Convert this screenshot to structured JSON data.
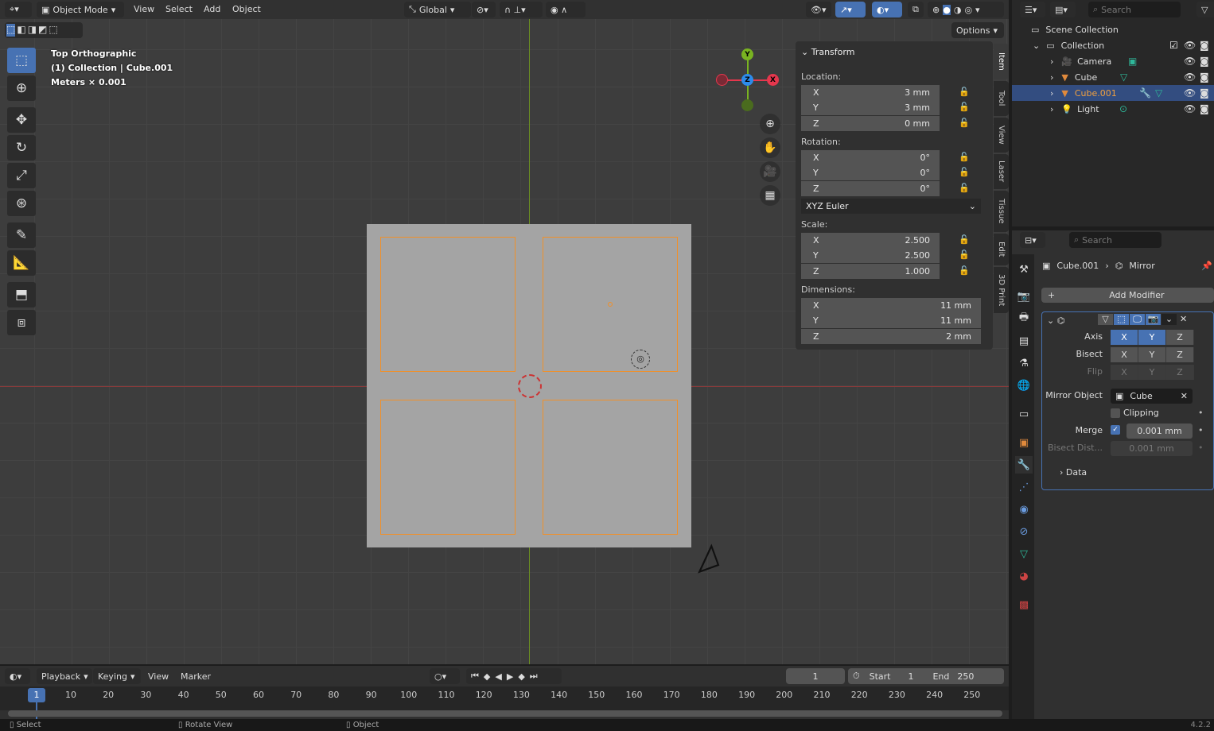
{
  "header": {
    "mode": "Object Mode",
    "menus": [
      "View",
      "Select",
      "Add",
      "Object"
    ],
    "orientation": "Global",
    "options_label": "Options"
  },
  "overlay": {
    "view_name": "Top Orthographic",
    "collection_line": "(1) Collection | Cube.001",
    "units": "Meters × 0.001"
  },
  "gizmo": {
    "x": "X",
    "y": "Y",
    "z": "Z",
    "x_color": "#e5374d",
    "y_color": "#79b321",
    "z_color": "#2d8ceb"
  },
  "npanel": {
    "panel_title": "Transform",
    "location_label": "Location:",
    "location": [
      {
        "axis": "X",
        "value": "3 mm"
      },
      {
        "axis": "Y",
        "value": "3 mm"
      },
      {
        "axis": "Z",
        "value": "0 mm"
      }
    ],
    "rotation_label": "Rotation:",
    "rotation": [
      {
        "axis": "X",
        "value": "0°"
      },
      {
        "axis": "Y",
        "value": "0°"
      },
      {
        "axis": "Z",
        "value": "0°"
      }
    ],
    "rotation_mode": "XYZ Euler",
    "scale_label": "Scale:",
    "scale": [
      {
        "axis": "X",
        "value": "2.500"
      },
      {
        "axis": "Y",
        "value": "2.500"
      },
      {
        "axis": "Z",
        "value": "1.000"
      }
    ],
    "dimensions_label": "Dimensions:",
    "dimensions": [
      {
        "axis": "X",
        "value": "11 mm"
      },
      {
        "axis": "Y",
        "value": "11 mm"
      },
      {
        "axis": "Z",
        "value": "2 mm"
      }
    ],
    "tabs": [
      "Item",
      "Tool",
      "View",
      "Laser",
      "Tissue",
      "Edit",
      "3D Print"
    ],
    "active_tab": "Item"
  },
  "outliner": {
    "search_placeholder": "Search",
    "scene_collection": "Scene Collection",
    "items": [
      {
        "name": "Collection"
      },
      {
        "name": "Camera"
      },
      {
        "name": "Cube"
      },
      {
        "name": "Cube.001",
        "selected": true
      },
      {
        "name": "Light"
      }
    ]
  },
  "properties": {
    "search_placeholder": "Search",
    "object": "Cube.001",
    "modifier": "Mirror",
    "add_modifier": "Add Modifier",
    "axis_label": "Axis",
    "bisect_label": "Bisect",
    "flip_label": "Flip",
    "axes": [
      "X",
      "Y",
      "Z"
    ],
    "axis_enabled": [
      true,
      true,
      false
    ],
    "mirror_object_label": "Mirror Object",
    "mirror_object": "Cube",
    "clipping_label": "Clipping",
    "clipping": false,
    "merge_label": "Merge",
    "merge": true,
    "merge_value": "0.001 mm",
    "bisect_dist_label": "Bisect Dist...",
    "bisect_dist_value": "0.001 mm",
    "data_label": "Data"
  },
  "timeline": {
    "menus": [
      "Playback",
      "Keying",
      "View",
      "Marker"
    ],
    "current_frame": "1",
    "start_label": "Start",
    "start": "1",
    "end_label": "End",
    "end": "250",
    "ticks": [
      "10",
      "20",
      "30",
      "40",
      "50",
      "60",
      "70",
      "80",
      "90",
      "100",
      "110",
      "120",
      "130",
      "140",
      "150",
      "160",
      "170",
      "180",
      "190",
      "200",
      "210",
      "220",
      "230",
      "240",
      "250"
    ]
  },
  "status": {
    "select": "Select",
    "rotate": "Rotate View",
    "object": "Object",
    "version": "4.2.2"
  }
}
